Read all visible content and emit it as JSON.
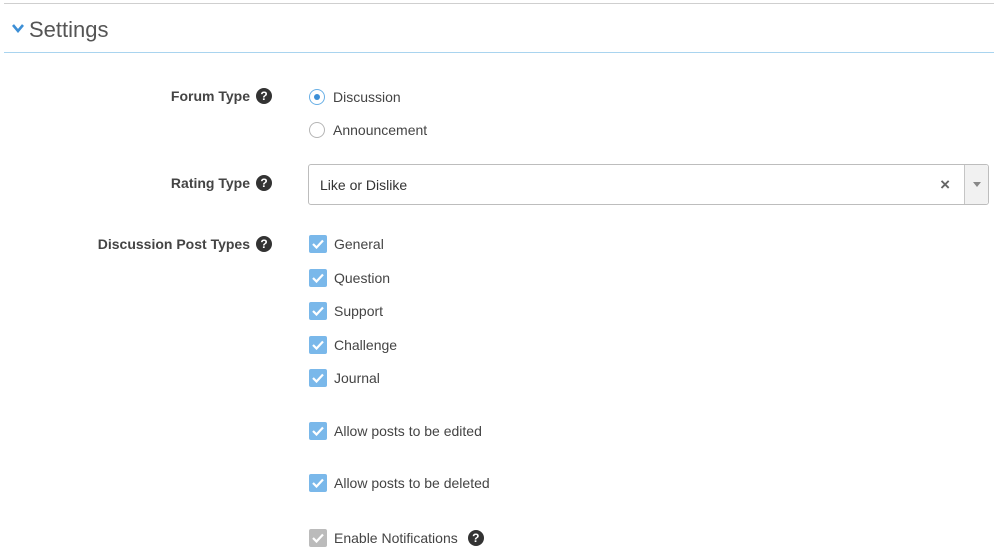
{
  "header": {
    "title": "Settings",
    "icon": "chevron-down-icon"
  },
  "forum_type": {
    "label": "Forum Type",
    "options": [
      {
        "label": "Discussion",
        "selected": true
      },
      {
        "label": "Announcement",
        "selected": false
      }
    ]
  },
  "rating_type": {
    "label": "Rating Type",
    "value": "Like or Dislike",
    "clear_glyph": "×"
  },
  "post_types": {
    "label": "Discussion Post Types",
    "items": [
      {
        "label": "General",
        "checked": true
      },
      {
        "label": "Question",
        "checked": true
      },
      {
        "label": "Support",
        "checked": true
      },
      {
        "label": "Challenge",
        "checked": true
      },
      {
        "label": "Journal",
        "checked": true
      }
    ]
  },
  "options": {
    "allow_edit": {
      "label": "Allow posts to be edited",
      "checked": true
    },
    "allow_delete": {
      "label": "Allow posts to be deleted",
      "checked": true
    },
    "notifications": {
      "label": "Enable Notifications",
      "checked": true,
      "disabled": true
    }
  },
  "help_glyph": "?",
  "colors": {
    "accent": "#3d8fd6",
    "checkbox": "#7ab8ea",
    "checkbox_disabled": "#bbbbbb",
    "header_rule": "#a9d4ef"
  }
}
